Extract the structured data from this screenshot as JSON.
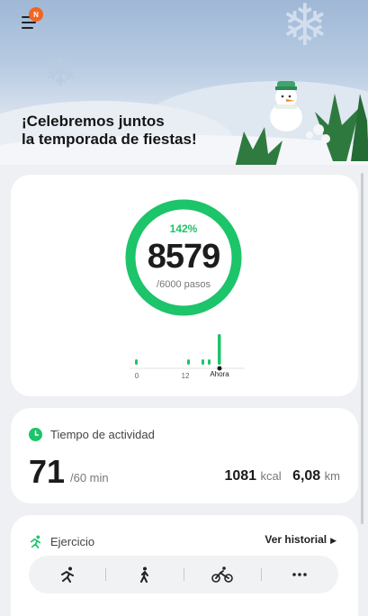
{
  "header": {
    "notification_badge": "N",
    "banner_line1": "¡Celebremos juntos",
    "banner_line2": "la temporada de fiestas!"
  },
  "steps": {
    "percent": "142%",
    "count": "8579",
    "goal": "/6000 pasos",
    "progress_fraction": 1.0,
    "chart_labels": [
      "0",
      "12",
      "Ahora"
    ]
  },
  "activity": {
    "title": "Tiempo de actividad",
    "minutes": "71",
    "goal_unit": "/60 min",
    "kcal_value": "1081",
    "kcal_unit": "kcal",
    "km_value": "6,08",
    "km_unit": "km"
  },
  "exercise": {
    "title": "Ejercicio",
    "history_link": "Ver historial",
    "icons": [
      "running-icon",
      "walking-icon",
      "cycling-icon",
      "more-icon"
    ]
  },
  "colors": {
    "accent_green": "#1cc46a",
    "badge_orange": "#f26522"
  }
}
